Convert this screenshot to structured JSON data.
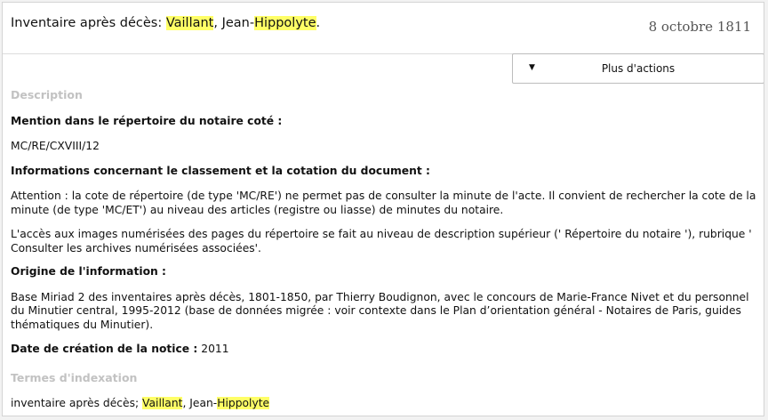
{
  "header": {
    "title_prefix": "Inventaire après décès: ",
    "title_name1": "Vaillant",
    "title_middle": ", Jean-",
    "title_name2": "Hippolyte",
    "title_suffix": ".",
    "date": "8 octobre 1811"
  },
  "actions": {
    "caret": "▼",
    "label": "Plus d'actions"
  },
  "description": {
    "heading": "Description",
    "mention_label": "Mention dans le répertoire du notaire coté :",
    "mention_value": "MC/RE/CXVIII/12",
    "classement_label": "Informations concernant le classement et la cotation du document :",
    "attention_text": "Attention : la cote de répertoire (de type 'MC/RE') ne permet pas de consulter la minute de l'acte. Il convient de rechercher la cote de la minute (de type 'MC/ET') au niveau des articles (registre ou liasse) de minutes du notaire.",
    "acces_text": "L'accès aux images numérisées des pages du répertoire se fait au niveau de description supérieur (' Répertoire du notaire '), rubrique ' Consulter les archives numérisées associées'.",
    "origine_label": "Origine de l'information :",
    "origine_text": "Base Miriad 2 des inventaires après décès, 1801-1850, par Thierry Boudignon, avec le concours de Marie-France Nivet et du personnel du Minutier central, 1995-2012 (base de données migrée : voir contexte dans le Plan d’orientation général - Notaires de Paris, guides thématiques du Minutier).",
    "date_label": "Date de création de la notice :",
    "date_value": "2011"
  },
  "indexation": {
    "heading": "Termes d'indexation",
    "term_prefix": "inventaire après décès; ",
    "term_name1": "Vaillant",
    "term_middle": ", Jean-",
    "term_name2": "Hippolyte"
  },
  "colors": {
    "highlight": "#ffff66",
    "section_heading": "#c2c2c2",
    "date": "#555555"
  }
}
